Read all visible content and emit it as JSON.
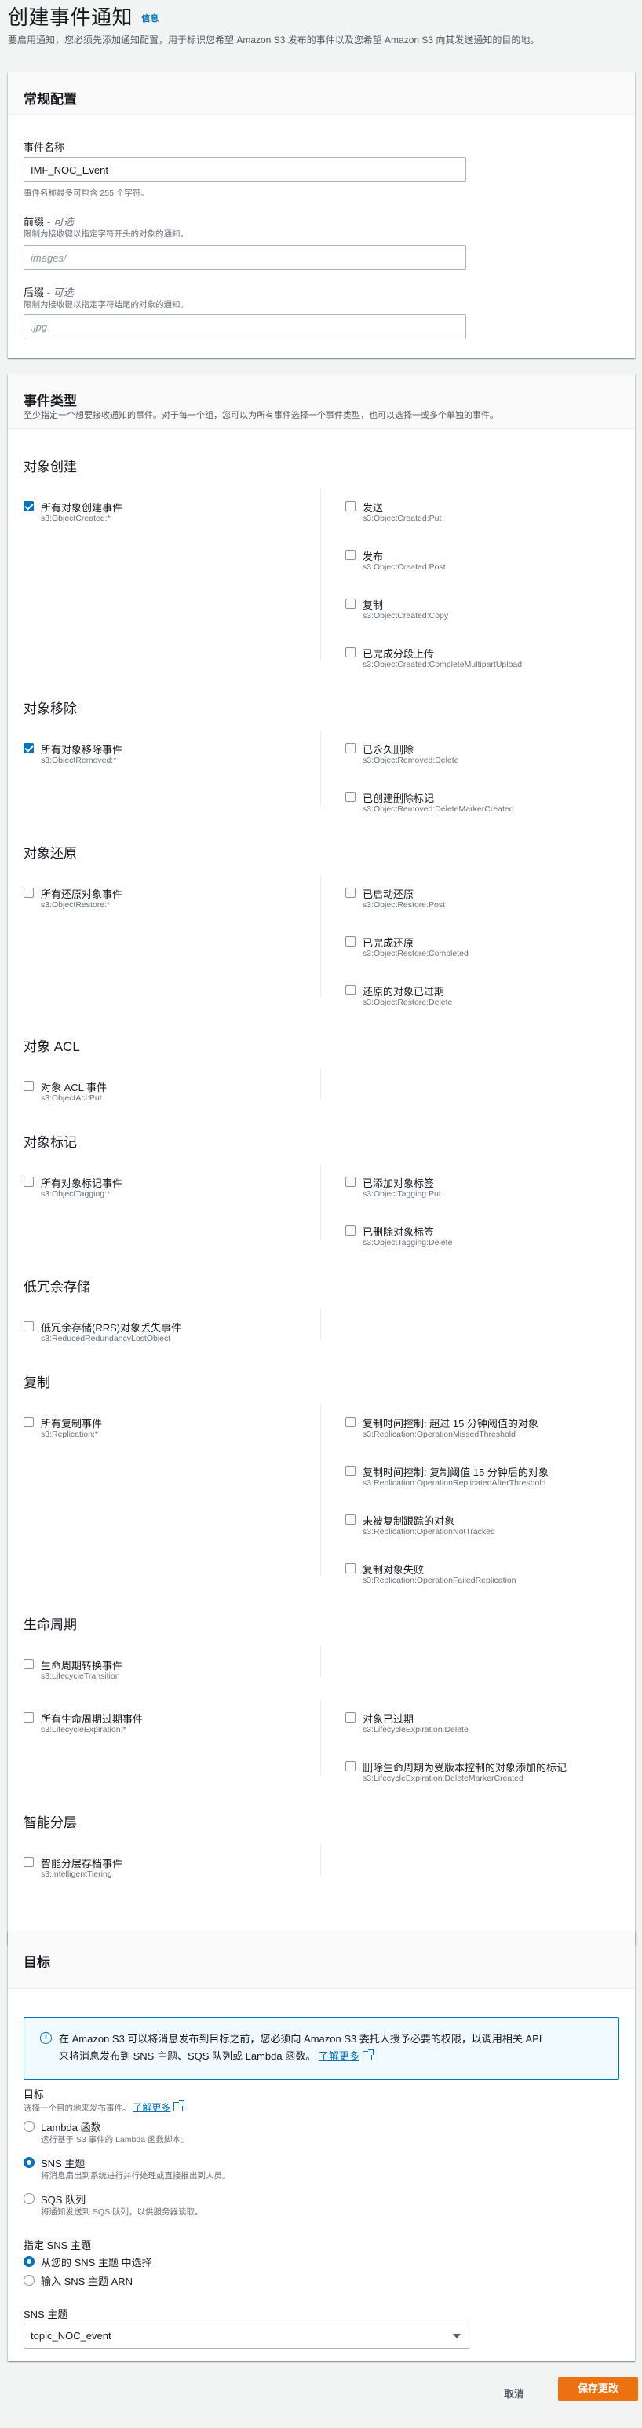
{
  "page": {
    "title": "创建事件通知",
    "info": "信息",
    "description": "要启用通知，您必须先添加通知配置，用于标识您希望 Amazon S3 发布的事件以及您希望 Amazon S3 向其发送通知的目的地。"
  },
  "general": {
    "title": "常规配置",
    "event_name": {
      "label": "事件名称",
      "value": "IMF_NOC_Event",
      "hint": "事件名称最多可包含 255 个字符。"
    },
    "prefix": {
      "label": "前缀",
      "optional": "- 可选",
      "desc": "限制为接收键以指定字符开头的对象的通知。",
      "placeholder": "images/"
    },
    "suffix": {
      "label": "后缀",
      "optional": "- 可选",
      "desc": "限制为接收键以指定字符结尾的对象的通知。",
      "placeholder": ".jpg"
    }
  },
  "event_types": {
    "title": "事件类型",
    "subtitle": "至少指定一个想要接收通知的事件。对于每一个组，您可以为所有事件选择一个事件类型，也可以选择一或多个单独的事件。",
    "groups": [
      {
        "title": "对象创建",
        "items": [
          {
            "label": "所有对象创建事件",
            "code": "s3:ObjectCreated:*",
            "checked": true
          },
          {
            "label": "发送",
            "code": "s3:ObjectCreated:Put",
            "checked": false
          },
          {
            "label": "发布",
            "code": "s3:ObjectCreated:Post",
            "checked": false
          },
          {
            "label": "复制",
            "code": "s3:ObjectCreated:Copy",
            "checked": false
          },
          {
            "label": "已完成分段上传",
            "code": "s3:ObjectCreated:CompleteMultipartUpload",
            "checked": false
          }
        ]
      },
      {
        "title": "对象移除",
        "items": [
          {
            "label": "所有对象移除事件",
            "code": "s3:ObjectRemoved:*",
            "checked": true
          },
          {
            "label": "已永久删除",
            "code": "s3:ObjectRemoved:Delete",
            "checked": false
          },
          {
            "label": "已创建删除标记",
            "code": "s3:ObjectRemoved:DeleteMarkerCreated",
            "checked": false
          }
        ]
      },
      {
        "title": "对象还原",
        "items": [
          {
            "label": "所有还原对象事件",
            "code": "s3:ObjectRestore:*",
            "checked": false
          },
          {
            "label": "已启动还原",
            "code": "s3:ObjectRestore:Post",
            "checked": false
          },
          {
            "label": "已完成还原",
            "code": "s3:ObjectRestore:Completed",
            "checked": false
          },
          {
            "label": "还原的对象已过期",
            "code": "s3:ObjectRestore:Delete",
            "checked": false
          }
        ]
      },
      {
        "title": "对象 ACL",
        "items": [
          {
            "label": "对象 ACL 事件",
            "code": "s3:ObjectAcl:Put",
            "checked": false
          }
        ]
      },
      {
        "title": "对象标记",
        "items": [
          {
            "label": "所有对象标记事件",
            "code": "s3:ObjectTagging:*",
            "checked": false
          },
          {
            "label": "已添加对象标签",
            "code": "s3:ObjectTagging:Put",
            "checked": false
          },
          {
            "label": "已删除对象标签",
            "code": "s3:ObjectTagging:Delete",
            "checked": false
          }
        ]
      },
      {
        "title": "低冗余存储",
        "items": [
          {
            "label": "低冗余存储(RRS)对象丢失事件",
            "code": "s3:ReducedRedundancyLostObject",
            "checked": false
          }
        ]
      },
      {
        "title": "复制",
        "items": [
          {
            "label": "所有复制事件",
            "code": "s3:Replication:*",
            "checked": false
          },
          {
            "label": "复制时间控制: 超过 15 分钟阈值的对象",
            "code": "s3:Replication:OperationMissedThreshold",
            "checked": false
          },
          {
            "label": "复制时间控制: 复制阈值 15 分钟后的对象",
            "code": "s3:Replication:OperationReplicatedAfterThreshold",
            "checked": false
          },
          {
            "label": "未被复制跟踪的对象",
            "code": "s3:Replication:OperationNotTracked",
            "checked": false
          },
          {
            "label": "复制对象失败",
            "code": "s3:Replication:OperationFailedReplication",
            "checked": false
          }
        ]
      },
      {
        "title": "生命周期",
        "items": [
          {
            "label": "生命周期转换事件",
            "code": "s3:LifecycleTransition",
            "checked": false
          },
          {
            "label": "所有生命周期过期事件",
            "code": "s3:LifecycleExpiration:*",
            "checked": false
          },
          {
            "label": "对象已过期",
            "code": "s3:LifecycleExpiration:Delete",
            "checked": false
          },
          {
            "label": "删除生命周期为受版本控制的对象添加的标记",
            "code": "s3:LifecycleExpiration:DeleteMarkerCreated",
            "checked": false
          }
        ]
      },
      {
        "title": "智能分层",
        "items": [
          {
            "label": "智能分层存档事件",
            "code": "s3:IntelligentTiering",
            "checked": false
          }
        ]
      }
    ]
  },
  "destination": {
    "title": "目标",
    "alert_line1": "在 Amazon S3 可以将消息发布到目标之前，您必须向 Amazon S3 委托人授予必要的权限，以调用相关 API",
    "alert_line2": "来将消息发布到 SNS 主题、SQS 队列或 Lambda 函数。",
    "alert_link": "了解更多",
    "target_label": "目标",
    "target_desc": "选择一个目的地来发布事件。",
    "target_link": "了解更多",
    "options": [
      {
        "label": "Lambda 函数",
        "desc": "运行基于 S3 事件的 Lambda 函数脚本。",
        "selected": false
      },
      {
        "label": "SNS 主题",
        "desc": "将消息扇出到系统进行并行处理或直接推出到人员。",
        "selected": true
      },
      {
        "label": "SQS 队列",
        "desc": "将通知发送到 SQS 队列，以供服务器读取。",
        "selected": false
      }
    ],
    "sns_specify_label": "指定 SNS 主题",
    "sns_specify_options": [
      {
        "label": "从您的 SNS 主题 中选择",
        "selected": true
      },
      {
        "label": "输入 SNS 主题 ARN",
        "selected": false
      }
    ],
    "sns_topic_label": "SNS 主题",
    "sns_topic_value": "topic_NOC_event"
  },
  "footer": {
    "cancel": "取消",
    "save": "保存更改"
  },
  "colors": {
    "primary": "#ec7211",
    "link": "#0073bb",
    "page_bg": "#f2f3f3"
  }
}
